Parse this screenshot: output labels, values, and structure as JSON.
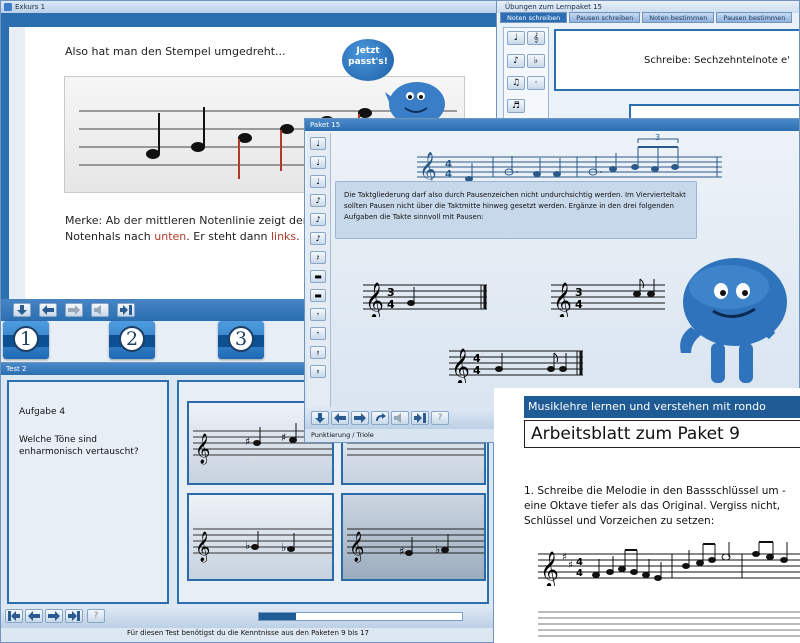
{
  "exkurs": {
    "title": "Exkurs 1",
    "text_top": "Also hat man den Stempel umgedreht...",
    "bubble": "Jetzt passt's!",
    "merke_line1": "Merke: Ab der mittleren Notenlinie zeigt der",
    "merke_line2_a": "Notenhals nach ",
    "merke_line2_b": "unten",
    "merke_line2_c": ". Er steht dann ",
    "merke_line2_d": "links",
    "merke_line2_e": ".",
    "numbers": [
      "1",
      "2",
      "3"
    ]
  },
  "uebungen": {
    "title": "Übungen zum Lernpaket 15",
    "tabs": [
      "Noten schreiben",
      "Pausen schreiben",
      "Noten bestimmen",
      "Pausen bestimmen"
    ],
    "prompt": "Schreibe: Sechzehntelnote e'",
    "palette": [
      "♩",
      "𝄞",
      "♪",
      "♭",
      "♫",
      "·",
      "♬"
    ]
  },
  "paket": {
    "title": "Paket 15",
    "text": "Die Taktgliederung darf also durch Pausenzeichen nicht undurchsichtig werden. Im Viervierteltakt sollten Pausen nicht über die Taktmitte hinweg gesetzt werden. Ergänze in den drei folgenden Aufgaben die Takte sinnvoll mit Pausen:",
    "triplet": "3",
    "time_a": [
      "3",
      "4"
    ],
    "time_b": [
      "3",
      "4"
    ],
    "time_c": [
      "4",
      "4"
    ],
    "status": "Punktierung / Triole"
  },
  "test": {
    "title": "Test 2",
    "aufgabe": "Aufgabe 4",
    "question": "Welche Töne sind enharmonisch vertauscht?",
    "footer": "Für diesen Test benötigst du die Kenntnisse aus den Paketen 9 bis 17"
  },
  "arbeitsblatt": {
    "header": "Musiklehre lernen und verstehen mit rondo",
    "title": "Arbeitsblatt zum Paket 9",
    "task": "1. Schreibe die Melodie in den Bassschlüssel um - eine Oktave tiefer als das Original. Vergiss nicht, Schlüssel und Vorzeichen zu setzen:",
    "time": [
      "4",
      "4"
    ]
  },
  "icons": {
    "help": "?",
    "treble": "𝄞"
  },
  "colors": {
    "accent_blue": "#2b6fb0",
    "note_red": "#b33a2b",
    "header_bar": "#1f5b94"
  }
}
